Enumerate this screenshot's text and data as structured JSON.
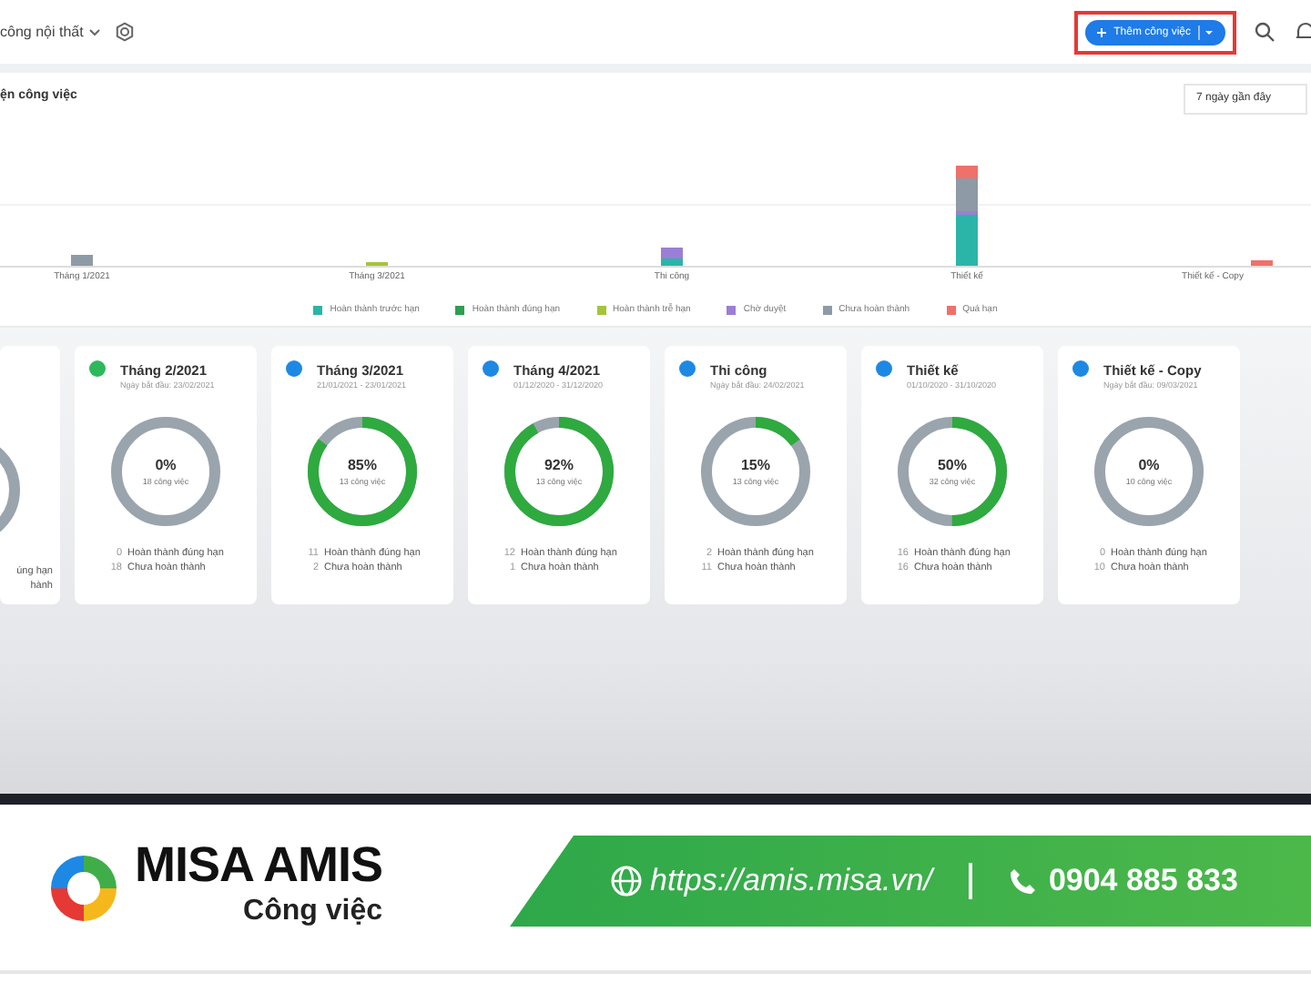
{
  "header": {
    "project": "công nội thất",
    "add_button": "Thêm công việc"
  },
  "chart_panel": {
    "title": "ện công việc",
    "range": "7 ngày gần đây",
    "categories": [
      "Tháng 1/2021",
      "Tháng 3/2021",
      "Thi công",
      "Thiết kế",
      "Thiết kế - Copy"
    ],
    "legend": [
      {
        "label": "Hoàn thành trước hạn",
        "color": "#2bb5a8"
      },
      {
        "label": "Hoàn thành đúng hạn",
        "color": "#2e9e4f"
      },
      {
        "label": "Hoàn thành trễ hạn",
        "color": "#a5c43a"
      },
      {
        "label": "Chờ duyệt",
        "color": "#9b7fd4"
      },
      {
        "label": "Chưa hoàn thành",
        "color": "#8e9aa5"
      },
      {
        "label": "Quá hạn",
        "color": "#f0706a"
      }
    ]
  },
  "partial_card": {
    "lines": [
      "úng hạn",
      "hành"
    ]
  },
  "cards": [
    {
      "title": "Tháng 2/2021",
      "dates": "Ngày bắt đầu: 23/02/2021",
      "color": "#2eb85c",
      "percent": "0%",
      "level": 0,
      "total": "18 công việc",
      "done_count": "0",
      "done_label": "Hoàn thành đúng hạn",
      "open_count": "18",
      "open_label": "Chưa hoàn thành"
    },
    {
      "title": "Tháng 3/2021",
      "dates": "21/01/2021 - 23/01/2021",
      "color": "#1e88e5",
      "percent": "85%",
      "level": 0.85,
      "total": "13 công việc",
      "done_count": "11",
      "done_label": "Hoàn thành đúng hạn",
      "open_count": "2",
      "open_label": "Chưa hoàn thành"
    },
    {
      "title": "Tháng 4/2021",
      "dates": "01/12/2020 - 31/12/2020",
      "color": "#1e88e5",
      "percent": "92%",
      "level": 0.92,
      "total": "13 công việc",
      "done_count": "12",
      "done_label": "Hoàn thành đúng hạn",
      "open_count": "1",
      "open_label": "Chưa hoàn thành"
    },
    {
      "title": "Thi công",
      "dates": "Ngày bắt đầu: 24/02/2021",
      "color": "#1e88e5",
      "percent": "15%",
      "level": 0.15,
      "total": "13 công việc",
      "done_count": "2",
      "done_label": "Hoàn thành đúng hạn",
      "open_count": "11",
      "open_label": "Chưa hoàn thành"
    },
    {
      "title": "Thiết kế",
      "dates": "01/10/2020 - 31/10/2020",
      "color": "#1e88e5",
      "percent": "50%",
      "level": 0.5,
      "total": "32 công việc",
      "done_count": "16",
      "done_label": "Hoàn thành đúng hạn",
      "open_count": "16",
      "open_label": "Chưa hoàn thành"
    },
    {
      "title": "Thiết kế - Copy",
      "dates": "Ngày bắt đầu: 09/03/2021",
      "color": "#1e88e5",
      "percent": "0%",
      "level": 0,
      "total": "10 công việc",
      "done_count": "0",
      "done_label": "Hoàn thành đúng hạn",
      "open_count": "10",
      "open_label": "Chưa hoàn thành"
    }
  ],
  "banner": {
    "brand": "MISA AMIS",
    "product": "Công việc",
    "url": "https://amis.misa.vn/",
    "phone": "0904 885 833"
  }
}
